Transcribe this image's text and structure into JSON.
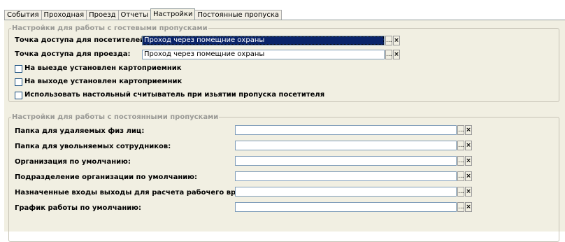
{
  "tabs": [
    {
      "label": "События",
      "active": false
    },
    {
      "label": "Проходная",
      "active": false
    },
    {
      "label": "Проезд",
      "active": false
    },
    {
      "label": "Отчеты",
      "active": false
    },
    {
      "label": "Настройки",
      "active": true
    },
    {
      "label": "Постоянные пропуска",
      "active": false
    }
  ],
  "guest": {
    "title": "Настройки для работы с гостевыми пропусками",
    "visitors_label": "Точка доступа для посетителей:",
    "visitors_value": "Проход через помещние охраны",
    "vehicles_label": "Точка доступа для проезда:",
    "vehicles_value": "Проход через помещние охраны",
    "checkboxes": [
      {
        "label": "На выезде установлен картоприемник",
        "checked": false
      },
      {
        "label": "На выходе установлен картоприемник",
        "checked": false
      },
      {
        "label": "Использовать настольный считыватель при изьятии пропуска посетителя",
        "checked": false
      }
    ]
  },
  "permanent": {
    "title": "Настройки для работы с постоянными пропусками",
    "fields": [
      {
        "label": "Папка для удаляемых физ лиц:",
        "value": ""
      },
      {
        "label": "Папка для увольняемых сотрудников:",
        "value": ""
      },
      {
        "label": "Организация по умолчанию:",
        "value": ""
      },
      {
        "label": "Подразделение организации по умолчанию:",
        "value": ""
      },
      {
        "label": "Назначенные входы выходы для расчета рабочего времени:",
        "value": ""
      },
      {
        "label": "График работы по умолчанию:",
        "value": ""
      }
    ]
  },
  "buttons": {
    "select": "...",
    "clear": "×"
  }
}
